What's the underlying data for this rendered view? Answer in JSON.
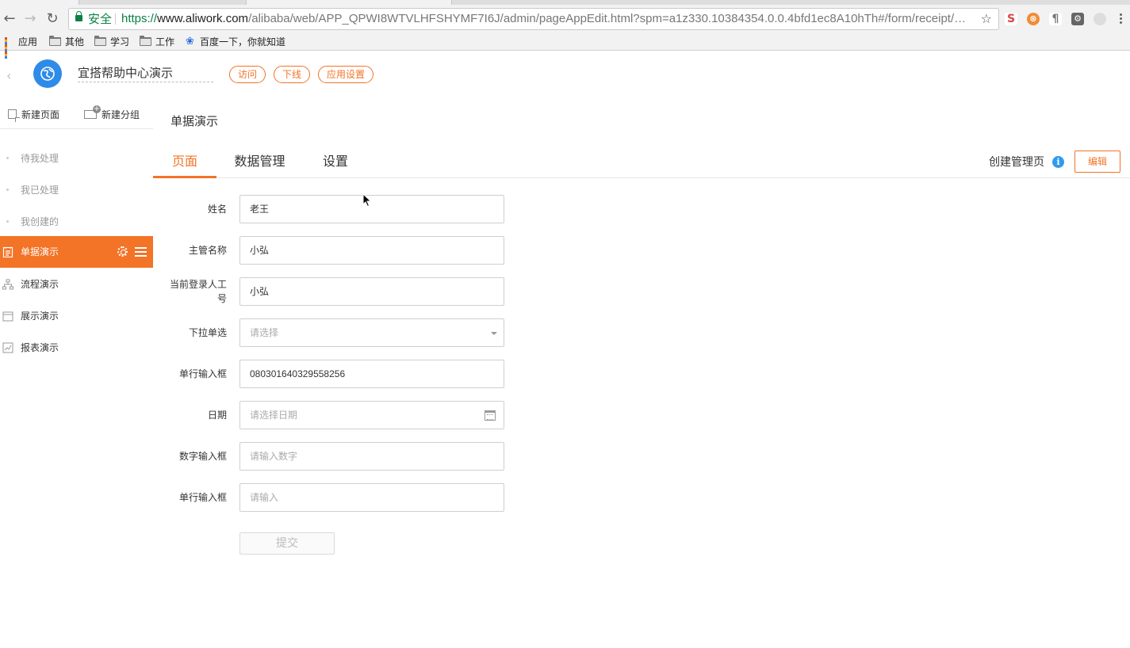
{
  "browser": {
    "secure_label": "安全",
    "url_scheme": "https://",
    "url_host": "www.aliwork.com",
    "url_path": "/alibaba/web/APP_QPWI8WTVLHFSHYMF7I6J/admin/pageAppEdit.html?spm=a1z330.10384354.0.0.4bfd1ec8A10hTh#/form/receipt/FORM-...",
    "bookmarks": [
      "应用",
      "其他",
      "学习",
      "工作",
      "百度一下，你就知道"
    ]
  },
  "header": {
    "app_name": "宜搭帮助中心演示",
    "visit_label": "访问",
    "offline_label": "下线",
    "settings_label": "应用设置"
  },
  "sidebar": {
    "new_page_label": "新建页面",
    "new_group_label": "新建分组",
    "items": [
      {
        "label": "待我处理"
      },
      {
        "label": "我已处理"
      },
      {
        "label": "我创建的"
      },
      {
        "label": "单据演示"
      },
      {
        "label": "流程演示"
      },
      {
        "label": "展示演示"
      },
      {
        "label": "报表演示"
      }
    ]
  },
  "main": {
    "title": "单据演示",
    "tabs": [
      {
        "label": "页面"
      },
      {
        "label": "数据管理"
      },
      {
        "label": "设置"
      }
    ],
    "create_manage_label": "创建管理页",
    "info_icon_glyph": "i",
    "edit_label": "编辑"
  },
  "form": {
    "fields": [
      {
        "label": "姓名",
        "value": "老王"
      },
      {
        "label": "主管名称",
        "value": "小弘"
      },
      {
        "label": "当前登录人工号",
        "value": "小弘"
      },
      {
        "label": "下拉单选",
        "placeholder": "请选择"
      },
      {
        "label": "单行输入框",
        "value": "080301640329558256"
      },
      {
        "label": "日期",
        "placeholder": "请选择日期"
      },
      {
        "label": "数字输入框",
        "placeholder": "请输入数字"
      },
      {
        "label": "单行输入框",
        "placeholder": "请输入"
      }
    ],
    "submit_label": "提交"
  },
  "colors": {
    "accent": "#f37327",
    "logo_blue": "#2e8be8",
    "info_blue": "#2f9bf0"
  }
}
